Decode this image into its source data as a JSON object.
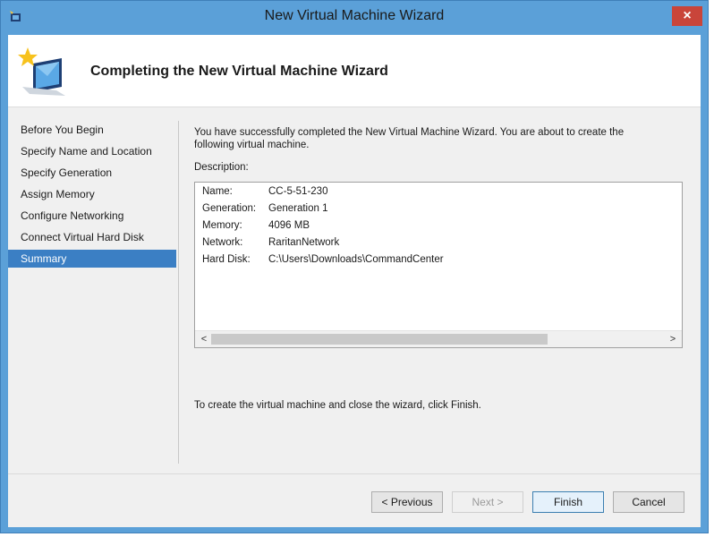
{
  "window": {
    "title": "New Virtual Machine Wizard",
    "close_label": "×"
  },
  "header": {
    "title": "Completing the New Virtual Machine Wizard"
  },
  "nav": {
    "items": [
      {
        "label": "Before You Begin",
        "active": false
      },
      {
        "label": "Specify Name and Location",
        "active": false
      },
      {
        "label": "Specify Generation",
        "active": false
      },
      {
        "label": "Assign Memory",
        "active": false
      },
      {
        "label": "Configure Networking",
        "active": false
      },
      {
        "label": "Connect Virtual Hard Disk",
        "active": false
      },
      {
        "label": "Summary",
        "active": true
      }
    ]
  },
  "content": {
    "intro": "You have successfully completed the New Virtual Machine Wizard. You are about to create the following virtual machine.",
    "description_label": "Description:",
    "description": [
      {
        "key": "Name:",
        "value": "CC-5-51-230"
      },
      {
        "key": "Generation:",
        "value": "Generation 1"
      },
      {
        "key": "Memory:",
        "value": "4096 MB"
      },
      {
        "key": "Network:",
        "value": "RaritanNetwork"
      },
      {
        "key": "Hard Disk:",
        "value": "C:\\Users\\Downloads\\CommandCenter"
      }
    ],
    "scroll_left": "<",
    "scroll_right": ">",
    "finish_note": "To create the virtual machine and close the wizard, click Finish."
  },
  "buttons": {
    "previous": "< Previous",
    "next": "Next >",
    "finish": "Finish",
    "cancel": "Cancel"
  },
  "colors": {
    "titlebar": "#5ba0d8",
    "close": "#c9453a",
    "nav_active": "#3b7fc4"
  },
  "icons": {
    "app": "hyper-v-icon",
    "header": "computer-wizard-icon"
  }
}
